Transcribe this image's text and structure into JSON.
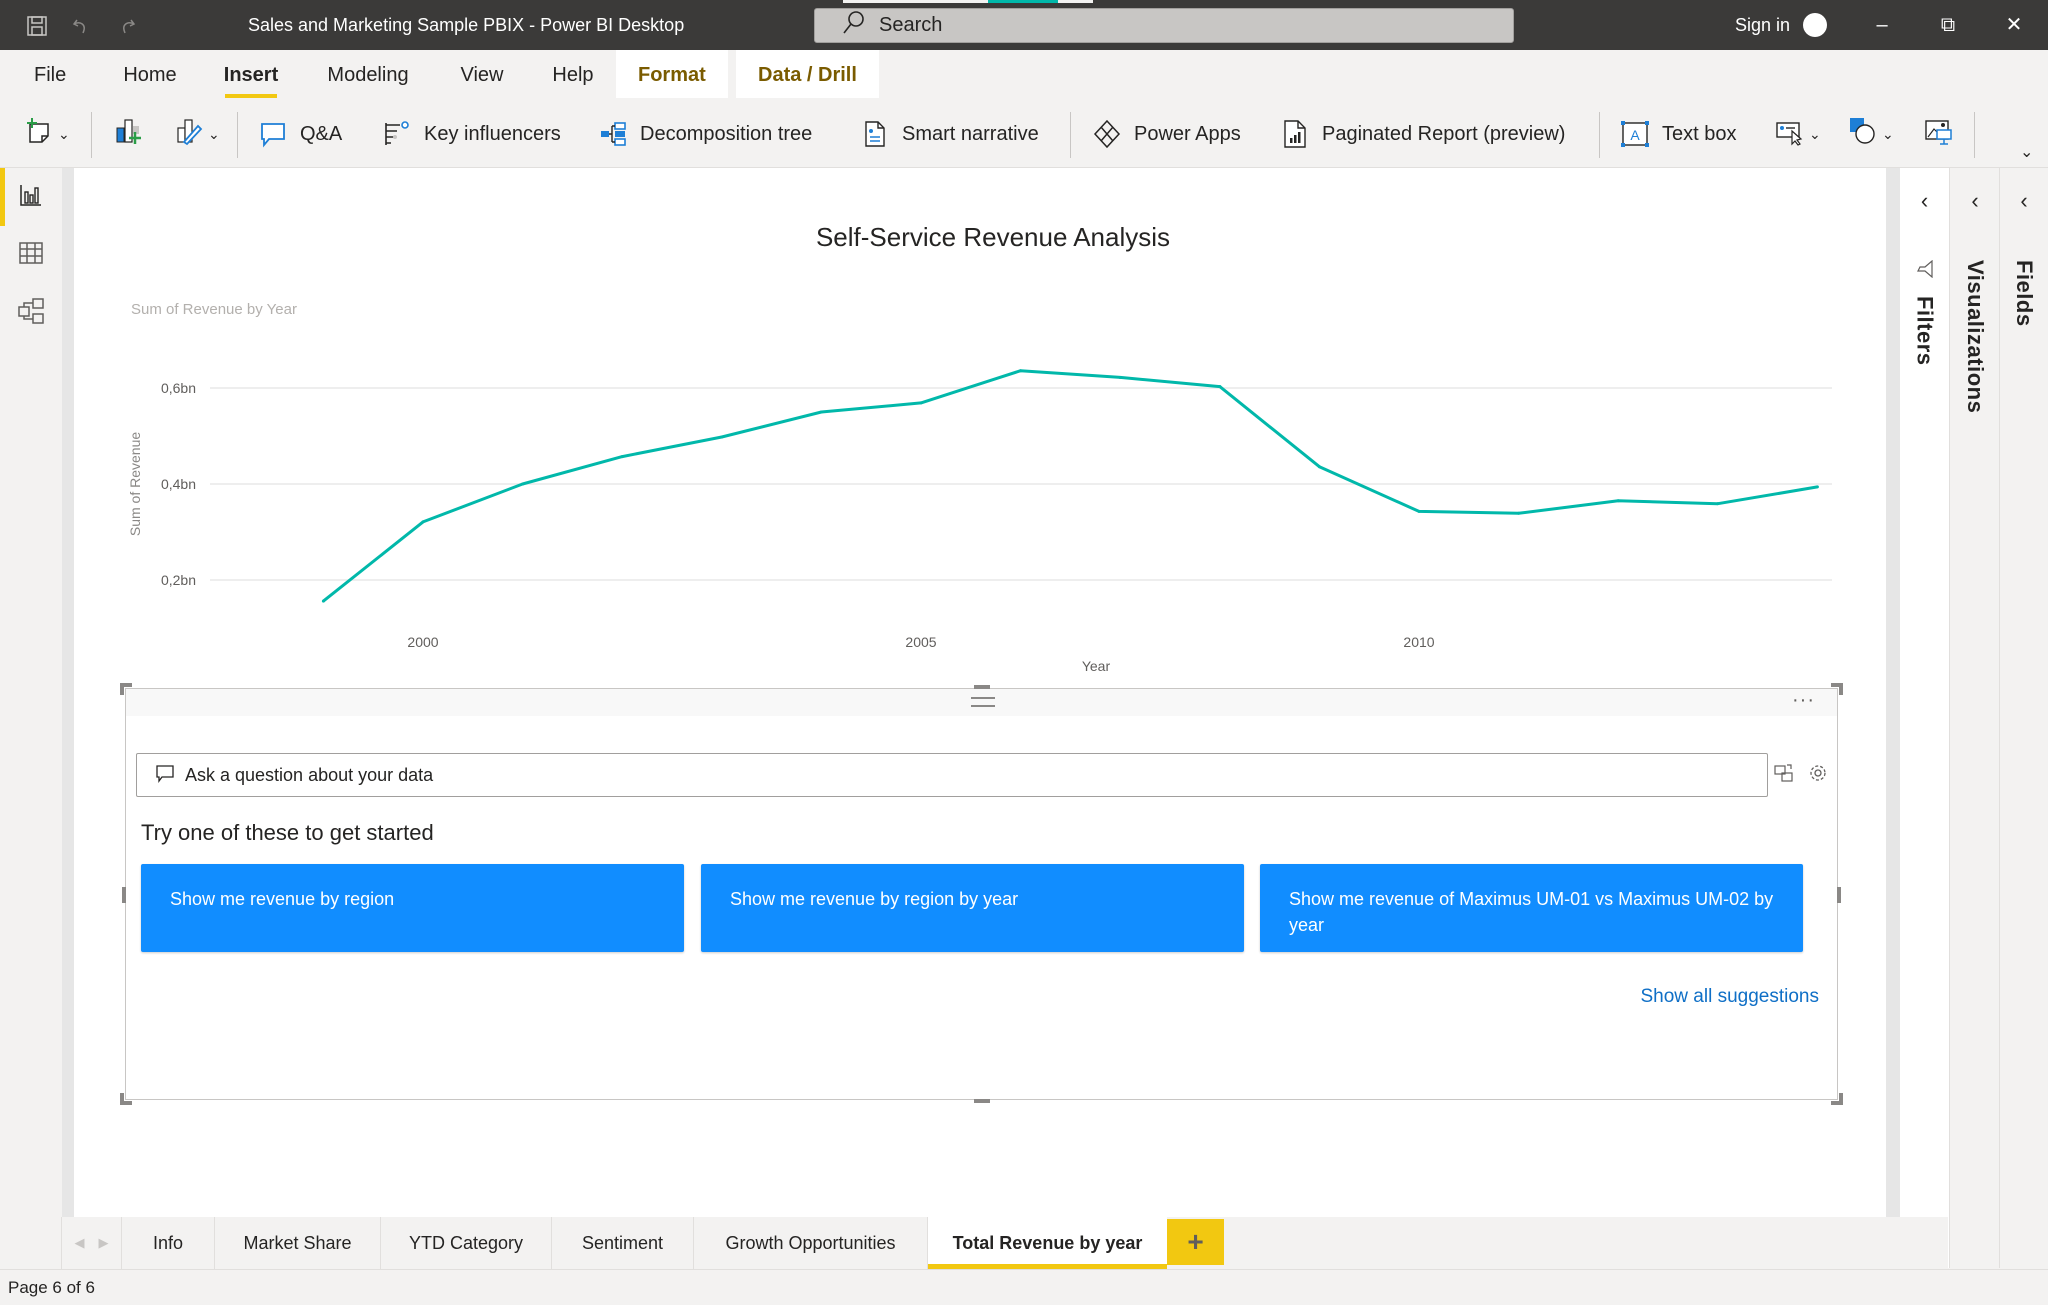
{
  "window": {
    "title": "Sales and Marketing Sample PBIX - Power BI Desktop",
    "search_placeholder": "Search",
    "sign_in": "Sign in",
    "minimize": "–",
    "restore": "⧉",
    "close": "✕"
  },
  "menu": {
    "tabs": [
      {
        "label": "File"
      },
      {
        "label": "Home"
      },
      {
        "label": "Insert",
        "active": true
      },
      {
        "label": "Modeling"
      },
      {
        "label": "View"
      },
      {
        "label": "Help"
      },
      {
        "label": "Format",
        "contextual": true
      },
      {
        "label": "Data / Drill",
        "contextual": true
      }
    ]
  },
  "ribbon": {
    "buttons": [
      {
        "label": "Q&A",
        "icon": "speech-bubble-icon"
      },
      {
        "label": "Key influencers",
        "icon": "key-influencers-icon"
      },
      {
        "label": "Decomposition tree",
        "icon": "decomposition-tree-icon"
      },
      {
        "label": "Smart narrative",
        "icon": "smart-narrative-icon"
      },
      {
        "label": "Power Apps",
        "icon": "power-apps-icon"
      },
      {
        "label": "Paginated Report (preview)",
        "icon": "paginated-report-icon"
      },
      {
        "label": "Text box",
        "icon": "text-box-icon"
      }
    ]
  },
  "leftnav": {
    "items": [
      {
        "name": "report-view",
        "active": true
      },
      {
        "name": "data-view"
      },
      {
        "name": "model-view"
      }
    ]
  },
  "report": {
    "title": "Self-Service Revenue Analysis"
  },
  "chart_data": {
    "type": "line",
    "title": "Sum of Revenue by Year",
    "xlabel": "Year",
    "ylabel": "Sum of Revenue",
    "x": [
      1999,
      2000,
      2001,
      2002,
      2003,
      2004,
      2005,
      2006,
      2007,
      2008,
      2009,
      2010,
      2011,
      2012,
      2013,
      2014
    ],
    "series": [
      {
        "name": "Sum of Revenue",
        "color": "#01b8aa",
        "values": [
          0.156,
          0.321,
          0.4,
          0.457,
          0.498,
          0.55,
          0.569,
          0.636,
          0.622,
          0.603,
          0.436,
          0.343,
          0.339,
          0.365,
          0.359,
          0.394
        ]
      }
    ],
    "unit": "bn",
    "yticks": [
      {
        "value": 0.2,
        "label": "0,2bn"
      },
      {
        "value": 0.4,
        "label": "0,4bn"
      },
      {
        "value": 0.6,
        "label": "0,6bn"
      }
    ],
    "xticks": [
      {
        "value": 2000,
        "label": "2000"
      },
      {
        "value": 2005,
        "label": "2005"
      },
      {
        "value": 2010,
        "label": "2010"
      }
    ],
    "xlim": [
      1997.4,
      2014.3
    ],
    "ylim": [
      0.08,
      0.72
    ],
    "grid": true,
    "legend": "none"
  },
  "qna": {
    "input_placeholder": "Ask a question about your data",
    "prompt": "Try one of these to get started",
    "suggestions": [
      {
        "label": "Show me revenue by region"
      },
      {
        "label": "Show me revenue by region by year"
      },
      {
        "label": "Show me revenue of Maximus UM-01 vs Maximus UM-02 by year"
      }
    ],
    "show_all": "Show all suggestions",
    "more": "···"
  },
  "panes": {
    "filters": "Filters",
    "visualizations": "Visualizations",
    "fields": "Fields"
  },
  "pages": {
    "tabs": [
      {
        "label": "Info"
      },
      {
        "label": "Market Share"
      },
      {
        "label": "YTD Category"
      },
      {
        "label": "Sentiment"
      },
      {
        "label": "Growth Opportunities"
      },
      {
        "label": "Total Revenue by year",
        "active": true
      }
    ],
    "add": "+",
    "indicator": "Page 6 of 6"
  }
}
